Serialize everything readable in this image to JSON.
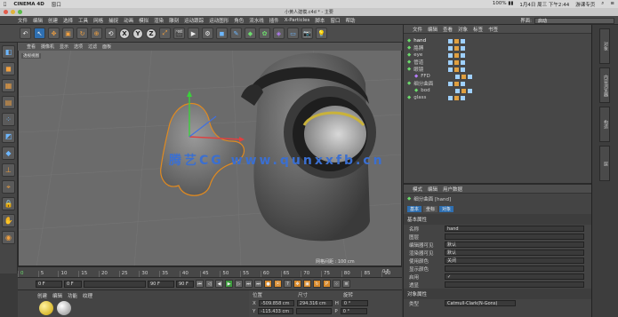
{
  "mac": {
    "app": "CINEMA 4D",
    "menu": "窗口",
    "status": "100% ▮▮",
    "date": "1月4日 周三 下午2:44",
    "user": "游课专页"
  },
  "window": {
    "title": "小黄人建模.c4d * - 主要"
  },
  "menubar": {
    "items": [
      "文件",
      "编辑",
      "创建",
      "选择",
      "工具",
      "网格",
      "捕捉",
      "动画",
      "模拟",
      "渲染",
      "雕刻",
      "运动跟踪",
      "运动图形",
      "角色",
      "流水线",
      "插件",
      "X-Particles",
      "脚本",
      "窗口",
      "帮助"
    ],
    "layout_label": "界面:",
    "layout_value": "启动"
  },
  "viewport": {
    "menu": [
      "查看",
      "摄像机",
      "显示",
      "选项",
      "过滤",
      "面板"
    ],
    "label": "透视视图",
    "grid_spacing": "网格间距 : 100 cm",
    "watermark": "腾艺CG www.qunxxfb.cn"
  },
  "timeline": {
    "ticks": [
      "0",
      "5",
      "10",
      "15",
      "20",
      "25",
      "30",
      "35",
      "40",
      "45",
      "50",
      "55",
      "60",
      "65",
      "70",
      "75",
      "80",
      "85",
      "90"
    ],
    "end": "0 F"
  },
  "playback": {
    "start": "0 F",
    "current": "0 F",
    "end": "90 F",
    "max": "90 F"
  },
  "material": {
    "menu": [
      "创建",
      "编辑",
      "功能",
      "纹理"
    ]
  },
  "coords": {
    "headers": [
      "位置",
      "尺寸",
      "旋转"
    ],
    "rows": [
      {
        "axis": "X",
        "pos": "-509.858 cm",
        "size": "294.316 cm",
        "rot_axis": "H",
        "rot": "0 °"
      },
      {
        "axis": "Y",
        "pos": "-115.433 cm",
        "size": "",
        "rot_axis": "P",
        "rot": "0 °"
      }
    ]
  },
  "objects": {
    "menu": [
      "文件",
      "编辑",
      "查看",
      "对象",
      "标签",
      "书签"
    ],
    "items": [
      {
        "name": "hand",
        "indent": 0
      },
      {
        "name": "胳膊",
        "indent": 0
      },
      {
        "name": "eye",
        "indent": 0
      },
      {
        "name": "管道",
        "indent": 0
      },
      {
        "name": "眼镜",
        "indent": 0
      },
      {
        "name": "FFD",
        "indent": 1
      },
      {
        "name": "细分曲面",
        "indent": 0
      },
      {
        "name": "bod",
        "indent": 1
      },
      {
        "name": "glass",
        "indent": 0
      }
    ]
  },
  "attributes": {
    "menu": [
      "模式",
      "编辑",
      "用户数据"
    ],
    "object_title": "细分曲面 [hand]",
    "tabs": [
      "基本",
      "坐标",
      "对象"
    ],
    "section_basic": "基本属性",
    "rows": [
      {
        "label": "名称",
        "value": "hand"
      },
      {
        "label": "图层",
        "value": ""
      },
      {
        "label": "编辑器可见",
        "value": "默认"
      },
      {
        "label": "渲染器可见",
        "value": "默认"
      },
      {
        "label": "使用颜色",
        "value": "关闭"
      },
      {
        "label": "显示颜色",
        "value": ""
      },
      {
        "label": "启用",
        "value": "✓"
      },
      {
        "label": "透显",
        "value": ""
      }
    ],
    "section_object": "对象属性",
    "type_label": "类型",
    "type_value": "Catmull-Clark(N-Gons)"
  },
  "rightbar": {
    "tabs": [
      "对象",
      "内容浏览器",
      "构造",
      "层"
    ]
  }
}
